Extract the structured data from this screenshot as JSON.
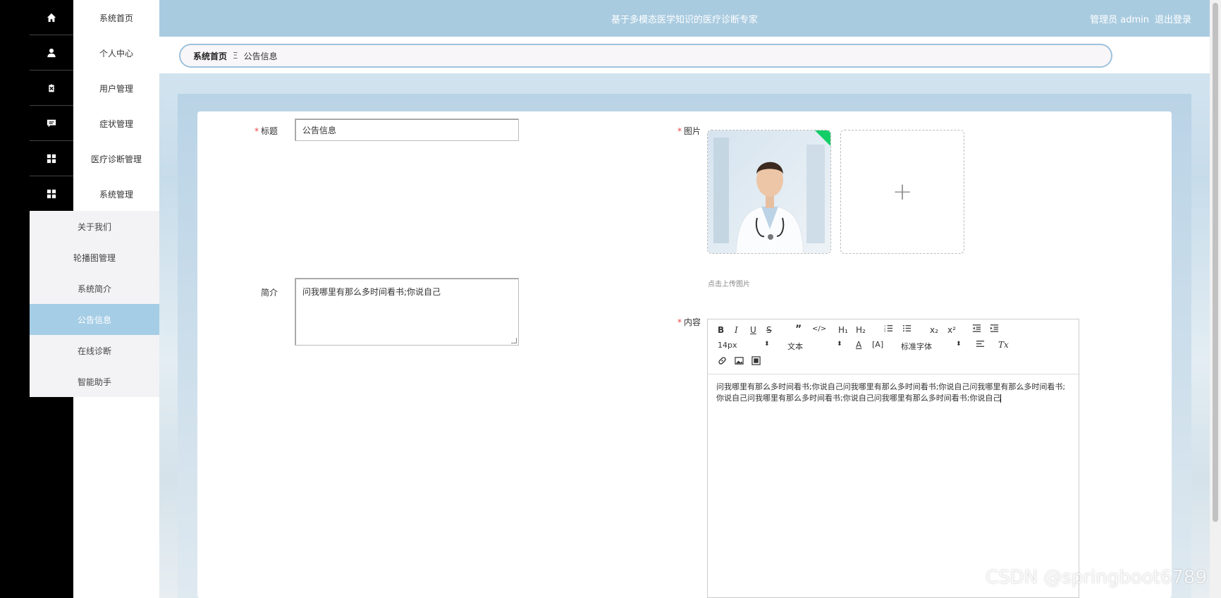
{
  "header": {
    "title": "基于多模态医学知识的医疗诊断专家",
    "user_label": "管理员 admin",
    "logout_label": "退出登录"
  },
  "sidebar": {
    "items": [
      {
        "label": "系统首页",
        "icon": "home-icon"
      },
      {
        "label": "个人中心",
        "icon": "user-icon"
      },
      {
        "label": "用户管理",
        "icon": "clipboard-icon"
      },
      {
        "label": "症状管理",
        "icon": "chat-icon"
      },
      {
        "label": "医疗诊断管理",
        "icon": "grid-icon"
      },
      {
        "label": "系统管理",
        "icon": "grid-icon"
      }
    ],
    "submenu": [
      {
        "label": "关于我们"
      },
      {
        "label": "轮播图管理"
      },
      {
        "label": "系统简介"
      },
      {
        "label": "公告信息",
        "active": true
      },
      {
        "label": "在线诊断"
      },
      {
        "label": "智能助手"
      }
    ]
  },
  "breadcrumb": {
    "home": "系统首页",
    "separator": "Ξ",
    "current": "公告信息"
  },
  "form": {
    "title_label": "标题",
    "title_value": "公告信息",
    "image_label": "图片",
    "upload_tip": "点击上传图片",
    "intro_label": "简介",
    "intro_value": "问我哪里有那么多时间看书;你说自己",
    "content_label": "内容",
    "content_value": "问我哪里有那么多时间看书;你说自己问我哪里有那么多时间看书;你说自己问我哪里有那么多时间看书;你说自己问我哪里有那么多时间看书;你说自己问我哪里有那么多时间看书;你说自己"
  },
  "editor_toolbar": {
    "font_size": "14px",
    "header_select": "文本",
    "font_family": "标准字体"
  },
  "colors": {
    "topbar": "#a9cbe0",
    "active_submenu": "#a6cde6",
    "required_star": "#e44444",
    "upload_ok": "#13ce66"
  },
  "watermark": "CSDN @springboot6789"
}
